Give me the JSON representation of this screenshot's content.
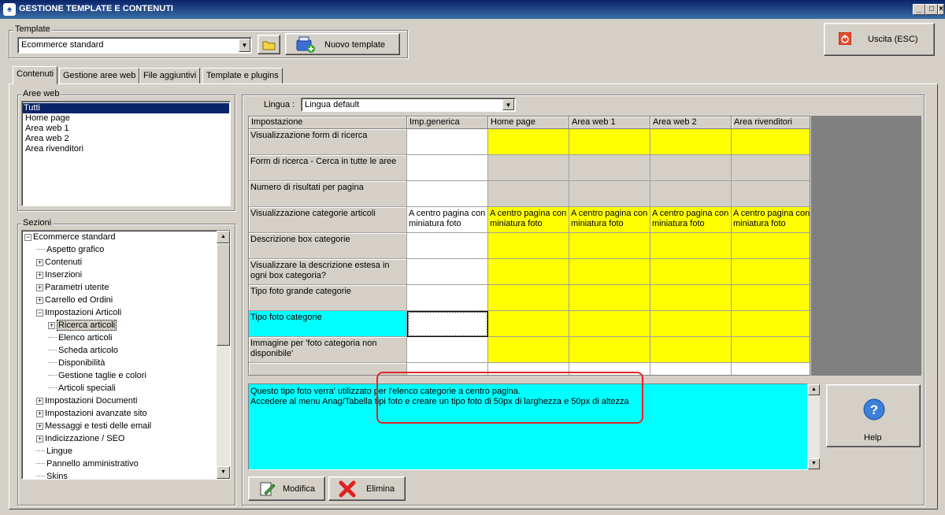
{
  "window": {
    "title": "GESTIONE TEMPLATE E CONTENUTI",
    "controls": {
      "minimize": "_",
      "maximize": "□",
      "close": "X"
    }
  },
  "template_group": {
    "label": "Template",
    "selected": "Ecommerce standard",
    "new_button": "Nuovo template"
  },
  "exit_button": "Uscita (ESC)",
  "tabs": [
    "Contenuti",
    "Gestione aree web",
    "File aggiuntivi",
    "Template e plugins"
  ],
  "aree_web": {
    "label": "Aree web",
    "items": [
      "Tutti",
      "Home page",
      "Area web 1",
      "Area web 2",
      "Area rivenditori"
    ],
    "selected_index": 0
  },
  "sezioni": {
    "label": "Sezioni",
    "tree": [
      {
        "label": "Ecommerce standard",
        "level": 0,
        "toggle": "−"
      },
      {
        "label": "Aspetto grafico",
        "level": 1,
        "toggle": ""
      },
      {
        "label": "Contenuti",
        "level": 1,
        "toggle": "+"
      },
      {
        "label": "Inserzioni",
        "level": 1,
        "toggle": "+"
      },
      {
        "label": "Parametri utente",
        "level": 1,
        "toggle": "+"
      },
      {
        "label": "Carrello ed Ordini",
        "level": 1,
        "toggle": "+"
      },
      {
        "label": "Impostazioni Articoli",
        "level": 1,
        "toggle": "−"
      },
      {
        "label": "Ricerca articoli",
        "level": 2,
        "toggle": "+",
        "selected": true
      },
      {
        "label": "Elenco articoli",
        "level": 2,
        "toggle": ""
      },
      {
        "label": "Scheda articolo",
        "level": 2,
        "toggle": ""
      },
      {
        "label": "Disponibilità",
        "level": 2,
        "toggle": ""
      },
      {
        "label": "Gestione taglie e colori",
        "level": 2,
        "toggle": ""
      },
      {
        "label": "Articoli speciali",
        "level": 2,
        "toggle": ""
      },
      {
        "label": "Impostazioni Documenti",
        "level": 1,
        "toggle": "+"
      },
      {
        "label": "Impostazioni avanzate sito",
        "level": 1,
        "toggle": "+"
      },
      {
        "label": "Messaggi e testi delle email",
        "level": 1,
        "toggle": "+"
      },
      {
        "label": "Indicizzazione / SEO",
        "level": 1,
        "toggle": "+"
      },
      {
        "label": "Lingue",
        "level": 1,
        "toggle": ""
      },
      {
        "label": "Pannello amministrativo",
        "level": 1,
        "toggle": ""
      },
      {
        "label": "Skins",
        "level": 1,
        "toggle": ""
      }
    ]
  },
  "lingua": {
    "label": "Lingua :",
    "selected": "Lingua default"
  },
  "grid": {
    "columns": [
      "Impostazione",
      "Imp.generica",
      "Home page",
      "Area web 1",
      "Area web 2",
      "Area rivenditori"
    ],
    "rows": [
      {
        "name": "Visualizzazione form di ricerca",
        "generic": "",
        "cells": [
          "",
          "",
          "",
          ""
        ],
        "style": "yellow"
      },
      {
        "name": "Form di ricerca - Cerca in tutte le aree",
        "generic": "",
        "cells": [
          "",
          "",
          "",
          ""
        ],
        "style": "gray"
      },
      {
        "name": "Numero di risultati per pagina",
        "generic": "",
        "cells": [
          "",
          "",
          "",
          ""
        ],
        "style": "gray"
      },
      {
        "name": "Visualizzazione categorie articoli",
        "generic": "A centro pagina con miniatura foto",
        "cells": [
          "A centro pagina con miniatura foto",
          "A centro pagina con miniatura foto",
          "A centro pagina con miniatura foto",
          "A centro pagina con miniatura foto"
        ],
        "style": "yellow"
      },
      {
        "name": "Descrizione box categorie",
        "generic": "",
        "cells": [
          "",
          "",
          "",
          ""
        ],
        "style": "yellow"
      },
      {
        "name": "Visualizzare la descrizione estesa in ogni box categoria?",
        "generic": "",
        "cells": [
          "",
          "",
          "",
          ""
        ],
        "style": "yellow"
      },
      {
        "name": "Tipo foto grande categorie",
        "generic": "",
        "cells": [
          "",
          "",
          "",
          ""
        ],
        "style": "yellow"
      },
      {
        "name": "Tipo foto categorie",
        "generic": "",
        "cells": [
          "",
          "",
          "",
          ""
        ],
        "style": "yellow",
        "selected": true
      },
      {
        "name": "Immagine per 'foto categoria non disponibile'",
        "generic": "",
        "cells": [
          "",
          "",
          "",
          ""
        ],
        "style": "yellow"
      },
      {
        "name": "",
        "generic": "",
        "cells": [
          "",
          "",
          "",
          ""
        ],
        "style": "white"
      }
    ]
  },
  "description": {
    "line1": "Questo tipo foto verra' utilizzato per l'elenco categorie a centro pagina.",
    "line2": "Accedere al menu Anag/Tabella tipi foto e creare un tipo foto di 50px di larghezza e 50px di altezza"
  },
  "buttons": {
    "modifica": "Modifica",
    "elimina": "Elimina",
    "help": "Help"
  },
  "colors": {
    "yellow": "#ffff00",
    "cyan": "#00ffff",
    "face": "#d4d0c8",
    "title": "#0a246a",
    "highlight_box": "#e0262b"
  }
}
